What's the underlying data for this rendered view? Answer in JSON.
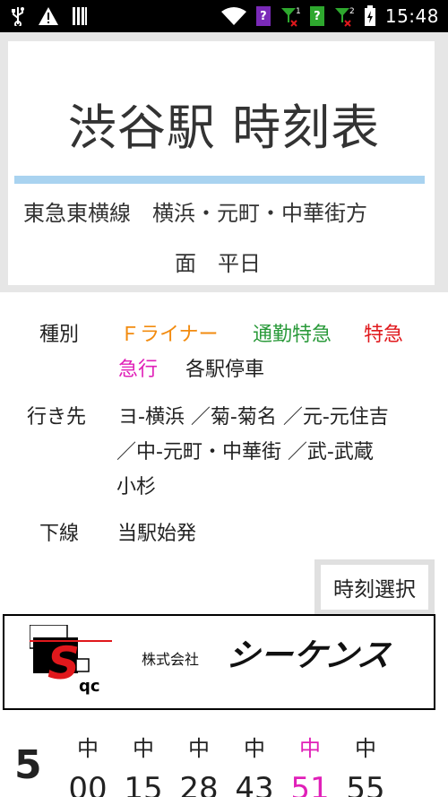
{
  "status_bar": {
    "time": "15:48",
    "icons": [
      "usb-icon",
      "warning-icon",
      "sd-card-icon",
      "wifi-icon",
      "no-sim-icon",
      "signal-1-icon",
      "no-sim-2-icon",
      "signal-2-icon",
      "battery-charging-icon"
    ],
    "sim1_badge": "?",
    "sim2_badge": "?",
    "signal1_sup": "1",
    "signal2_sup": "2"
  },
  "header": {
    "title": "渋谷駅 時刻表",
    "subtitle_line1": "東急東横線　横浜・元町・中華街方",
    "subtitle_line2": "面　平日",
    "accent_color": "#a9d3f0"
  },
  "info": {
    "type_label": "種別",
    "types": [
      {
        "name": "Ｆライナー",
        "color": "#f28b0f"
      },
      {
        "name": "通勤特急",
        "color": "#2a9a3a"
      },
      {
        "name": "特急",
        "color": "#e0181c"
      },
      {
        "name": "急行",
        "color": "#e020b8"
      },
      {
        "name": "各駅停車",
        "color": "#222222"
      }
    ],
    "dest_label": "行き先",
    "dest_line1": "ヨ-横浜 ／菊-菊名 ／元-元住吉",
    "dest_line2": "／中-元町・中華街 ／武-武蔵",
    "dest_line3": "小杉",
    "direction_label": "下線",
    "direction_value": "当駅始発"
  },
  "time_select_label": "時刻選択",
  "banner": {
    "company_name": "株式会社",
    "brand": "シーケンス",
    "logo_letters": "S",
    "logo_sub": "qc"
  },
  "timetable": {
    "hour": "5",
    "trains": [
      {
        "dest": "中",
        "minute": "00",
        "type": "kaku"
      },
      {
        "dest": "中",
        "minute": "15",
        "type": "kaku"
      },
      {
        "dest": "中",
        "minute": "28",
        "type": "kaku"
      },
      {
        "dest": "中",
        "minute": "43",
        "type": "kaku"
      },
      {
        "dest": "中",
        "minute": "51",
        "type": "kyu"
      },
      {
        "dest": "中",
        "minute": "55",
        "type": "kaku"
      }
    ]
  }
}
